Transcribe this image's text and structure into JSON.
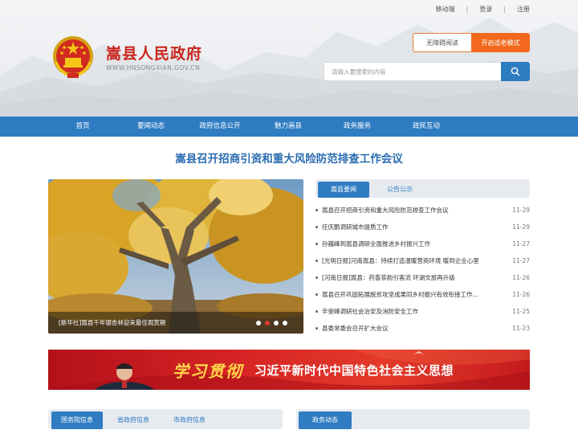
{
  "toplinks": {
    "mobile": "移动端",
    "login": "登录",
    "register": "注册",
    "sep": "|"
  },
  "site": {
    "title": "嵩县人民政府",
    "url": "WWW.HNSONGXIAN.GOV.CN"
  },
  "header_buttons": {
    "accessible": "无障碍阅读",
    "elder_mode": "开启适老模式"
  },
  "search": {
    "placeholder": "请输入要搜索的内容"
  },
  "nav": [
    "首页",
    "要闻动态",
    "政府信息公开",
    "魅力嵩县",
    "政务服务",
    "政民互动"
  ],
  "headline": "嵩县召开招商引资和重大风险防范排查工作会议",
  "slider": {
    "caption": "[新华社]嵩县千年银杏林迎来最佳观赏期",
    "dot_count": 4,
    "active_dot": 1
  },
  "news_tabs": [
    "嵩县要闻",
    "公告公示"
  ],
  "news": [
    {
      "title": "嵩县召开招商引资和重大风险防范排查工作会议",
      "date": "11-29"
    },
    {
      "title": "任庆鹏调研城市提质工作",
      "date": "11-29"
    },
    {
      "title": "孙巍峰到嵩县调研全面推进乡村振兴工作",
      "date": "11-27"
    },
    {
      "title": "[光明日报]河南嵩县：持续打造温暖营商环境 暖到企业心里",
      "date": "11-27"
    },
    {
      "title": "[河南日报]嵩县：药香茶韵引客流 环湖文旅再升级",
      "date": "11-26"
    },
    {
      "title": "嵩县召开巩固拓展脱贫攻坚成果同乡村振兴有效衔接工作…",
      "date": "11-26"
    },
    {
      "title": "辛俊峰调研社会治安及消防安全工作",
      "date": "11-25"
    },
    {
      "title": "县委常委会召开扩大会议",
      "date": "11-23"
    }
  ],
  "banner": {
    "calligraphy": "学习贯彻",
    "slogan": "习近平新时代中国特色社会主义思想"
  },
  "bottom_tabs_left": [
    "国务院信息",
    "省政府信息",
    "市政府信息"
  ],
  "bottom_tabs_right": [
    "政务动态"
  ],
  "colors": {
    "brand_blue": "#2f7cc2",
    "brand_red": "#c9261d",
    "orange": "#f2691d"
  }
}
